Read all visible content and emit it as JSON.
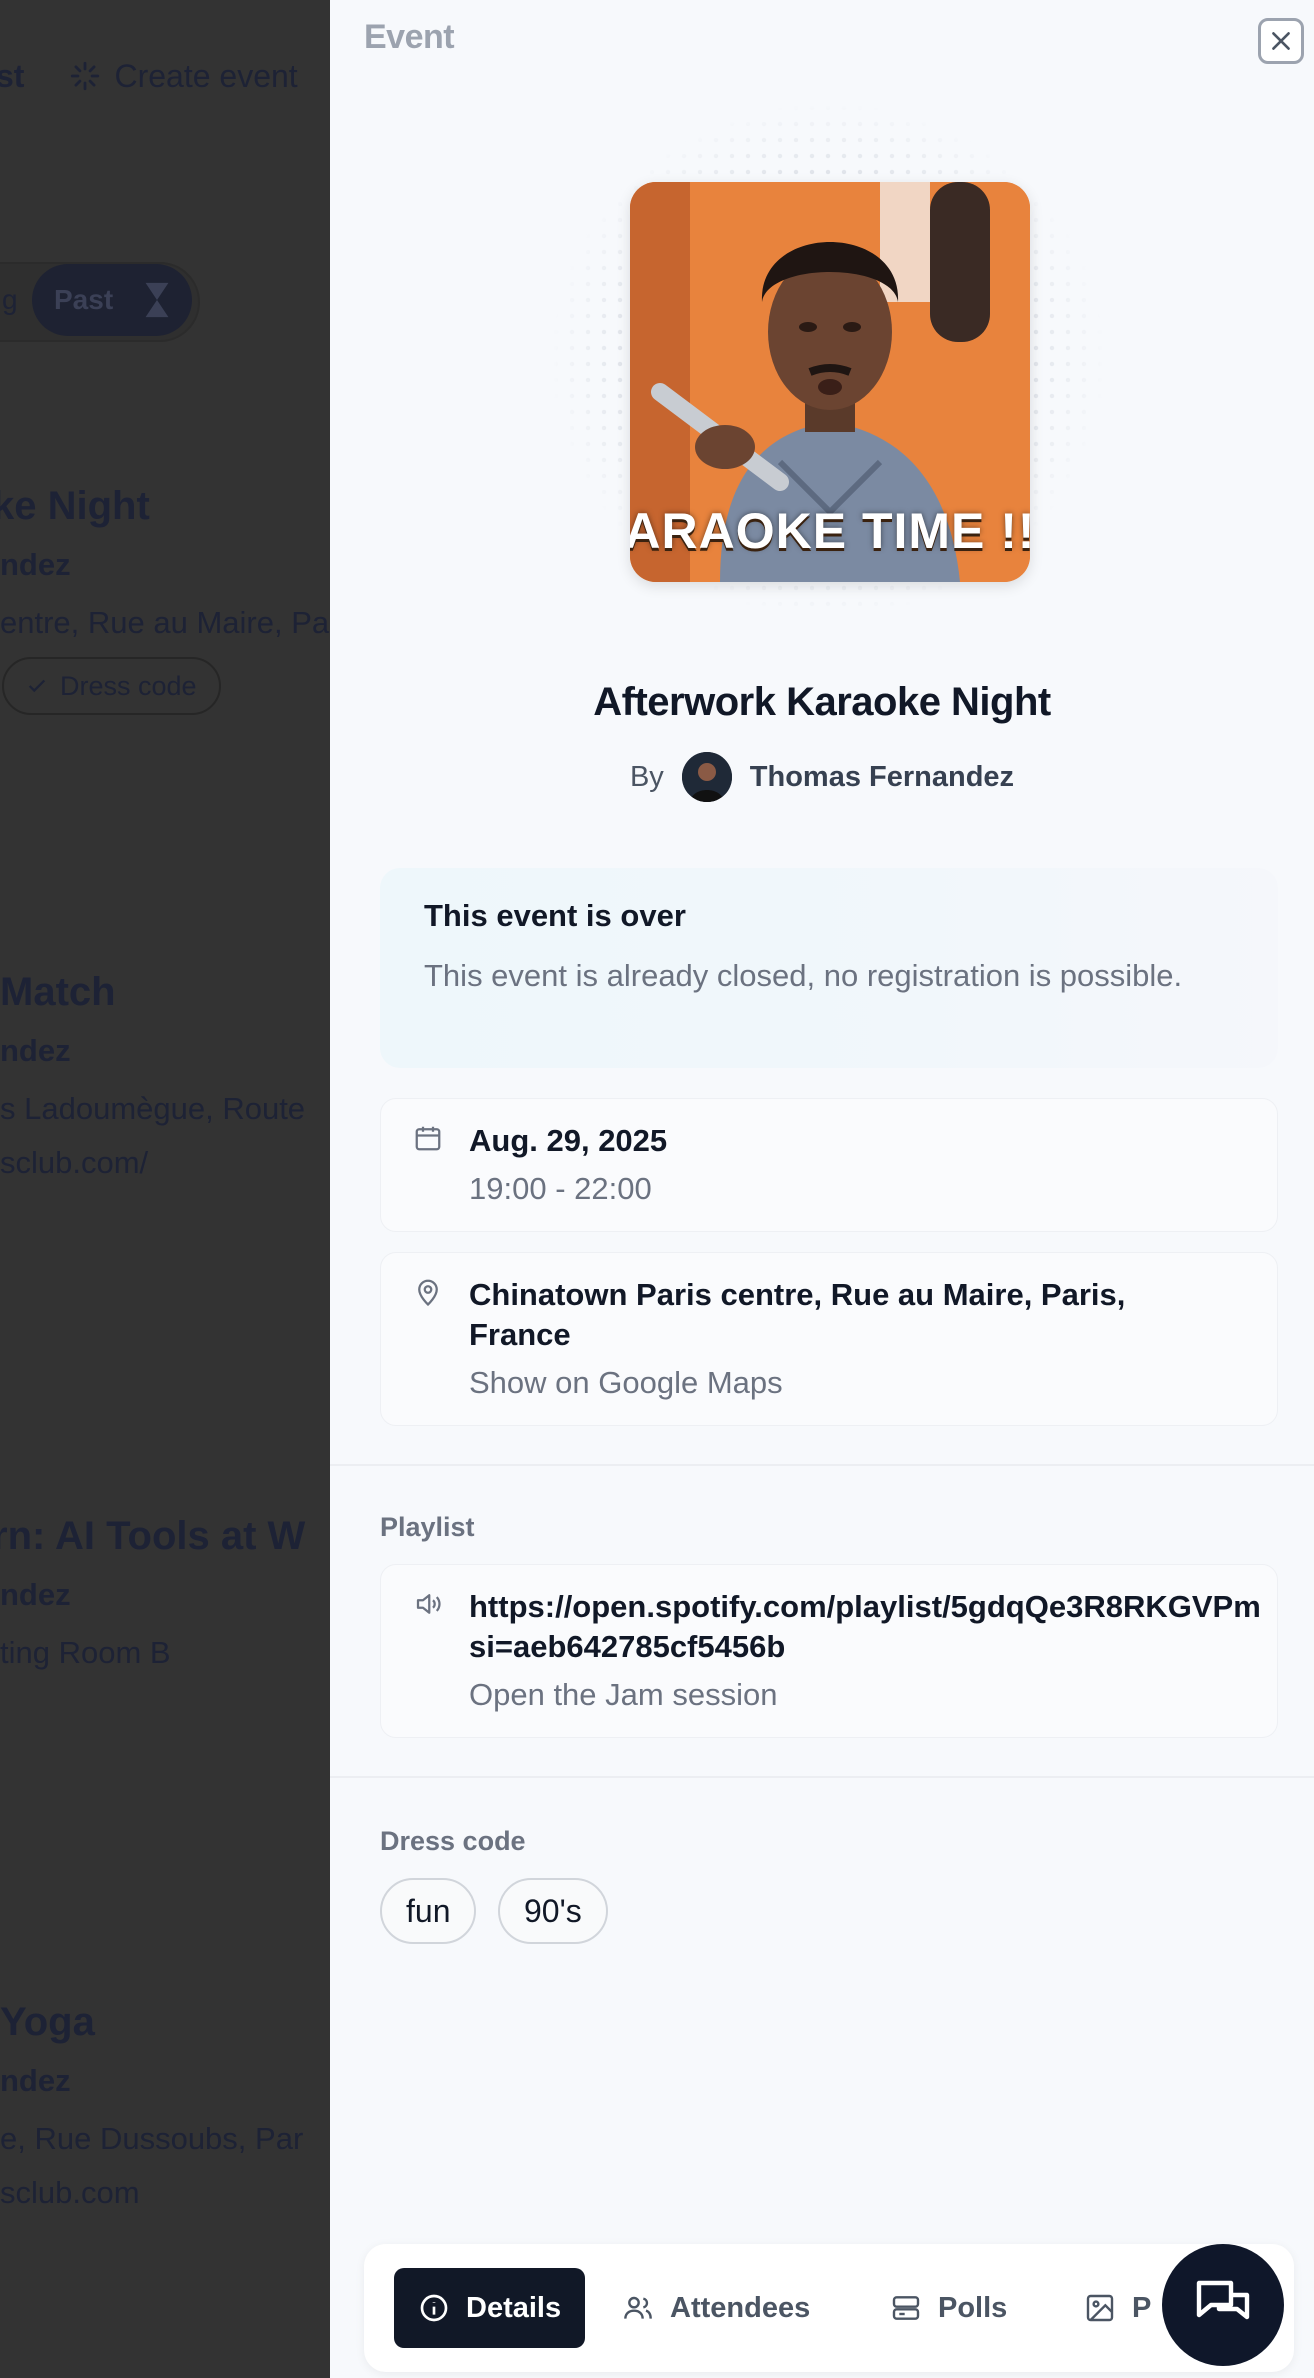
{
  "background": {
    "top_nav": {
      "partial_left": "st",
      "create_event": "Create event"
    },
    "filter": {
      "partial_left": "g",
      "past": "Past"
    },
    "events": [
      {
        "title": "ke Night",
        "host": "ndez",
        "line1": "entre, Rue au Maire, Pa",
        "line2": "",
        "tag": "Dress code"
      },
      {
        "title": "Match",
        "host": "ndez",
        "line1": "s Ladoumègue, Route",
        "line2": "sclub.com/"
      },
      {
        "title": "rn: AI Tools at W",
        "host": "ndez",
        "line1": "ting Room B",
        "line2": ""
      },
      {
        "title": "Yoga",
        "host": "ndez",
        "line1": "e, Rue Dussoubs, Par",
        "line2": "sclub.com"
      }
    ]
  },
  "drawer": {
    "title": "Event",
    "cover": {
      "caption": "ARAOKE TIME !!"
    },
    "event_name": "Afterwork Karaoke Night",
    "by_label": "By",
    "host_name": "Thomas Fernandez",
    "notice": {
      "title": "This event is over",
      "text": "This event is already closed, no registration is possible."
    },
    "date": {
      "day": "Aug. 29, 2025",
      "time": "19:00 - 22:00"
    },
    "location": {
      "address": "Chinatown Paris centre, Rue au Maire, Paris, France",
      "link": "Show on Google Maps"
    },
    "playlist": {
      "label": "Playlist",
      "url": "https://open.spotify.com/playlist/5gdqQe3R8RKGVPm si=aeb642785cf5456b",
      "link": "Open the Jam session"
    },
    "dress_code": {
      "label": "Dress code",
      "tags": [
        "fun",
        "90's"
      ]
    },
    "tabs": [
      "Details",
      "Attendees",
      "Polls",
      "P"
    ]
  },
  "colors": {
    "accent_dark": "#111827",
    "overlay": "#333333",
    "muted": "#6b7280"
  }
}
